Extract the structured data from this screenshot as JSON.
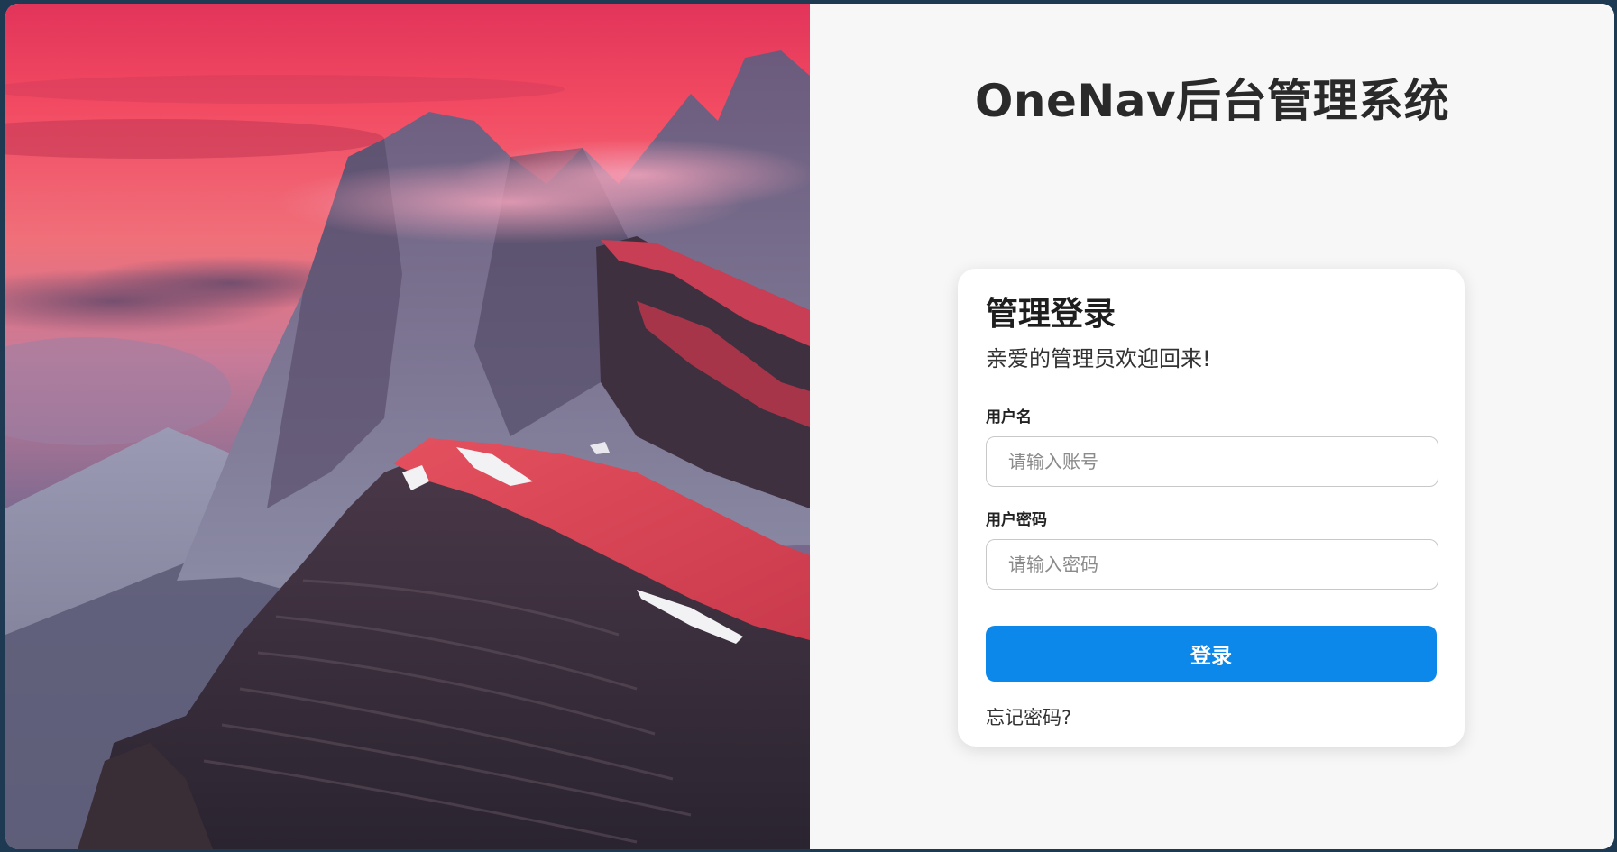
{
  "app": {
    "title": "OneNav后台管理系统"
  },
  "login_card": {
    "title": "管理登录",
    "subtitle": "亲爱的管理员欢迎回来!",
    "username": {
      "label": "用户名",
      "placeholder": "请输入账号",
      "value": ""
    },
    "password": {
      "label": "用户密码",
      "placeholder": "请输入密码",
      "value": ""
    },
    "submit_label": "登录",
    "forgot_link": "忘记密码?"
  },
  "colors": {
    "accent": "#0b88ea",
    "panel_background": "#f7f7f7",
    "page_border": "#1d3a52"
  },
  "hero_image": {
    "subject": "mountain-ridge-sunset"
  }
}
